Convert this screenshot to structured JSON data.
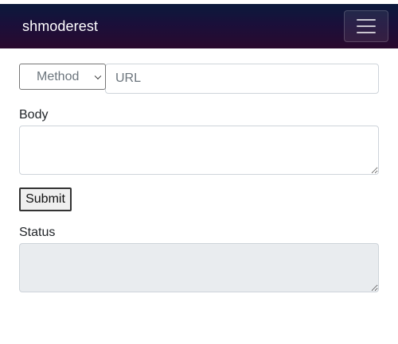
{
  "navbar": {
    "brand": "shmoderest",
    "toggler_icon": "hamburger-menu-icon"
  },
  "request": {
    "method_placeholder": "Method",
    "url_placeholder": "URL",
    "url_value": "",
    "body_label": "Body",
    "body_value": "",
    "submit_label": "Submit"
  },
  "response": {
    "status_label": "Status",
    "status_value": ""
  },
  "colors": {
    "navbar_start": "#0b1a3c",
    "navbar_end": "#2a0a2e",
    "status_bg": "#e9ecef"
  }
}
